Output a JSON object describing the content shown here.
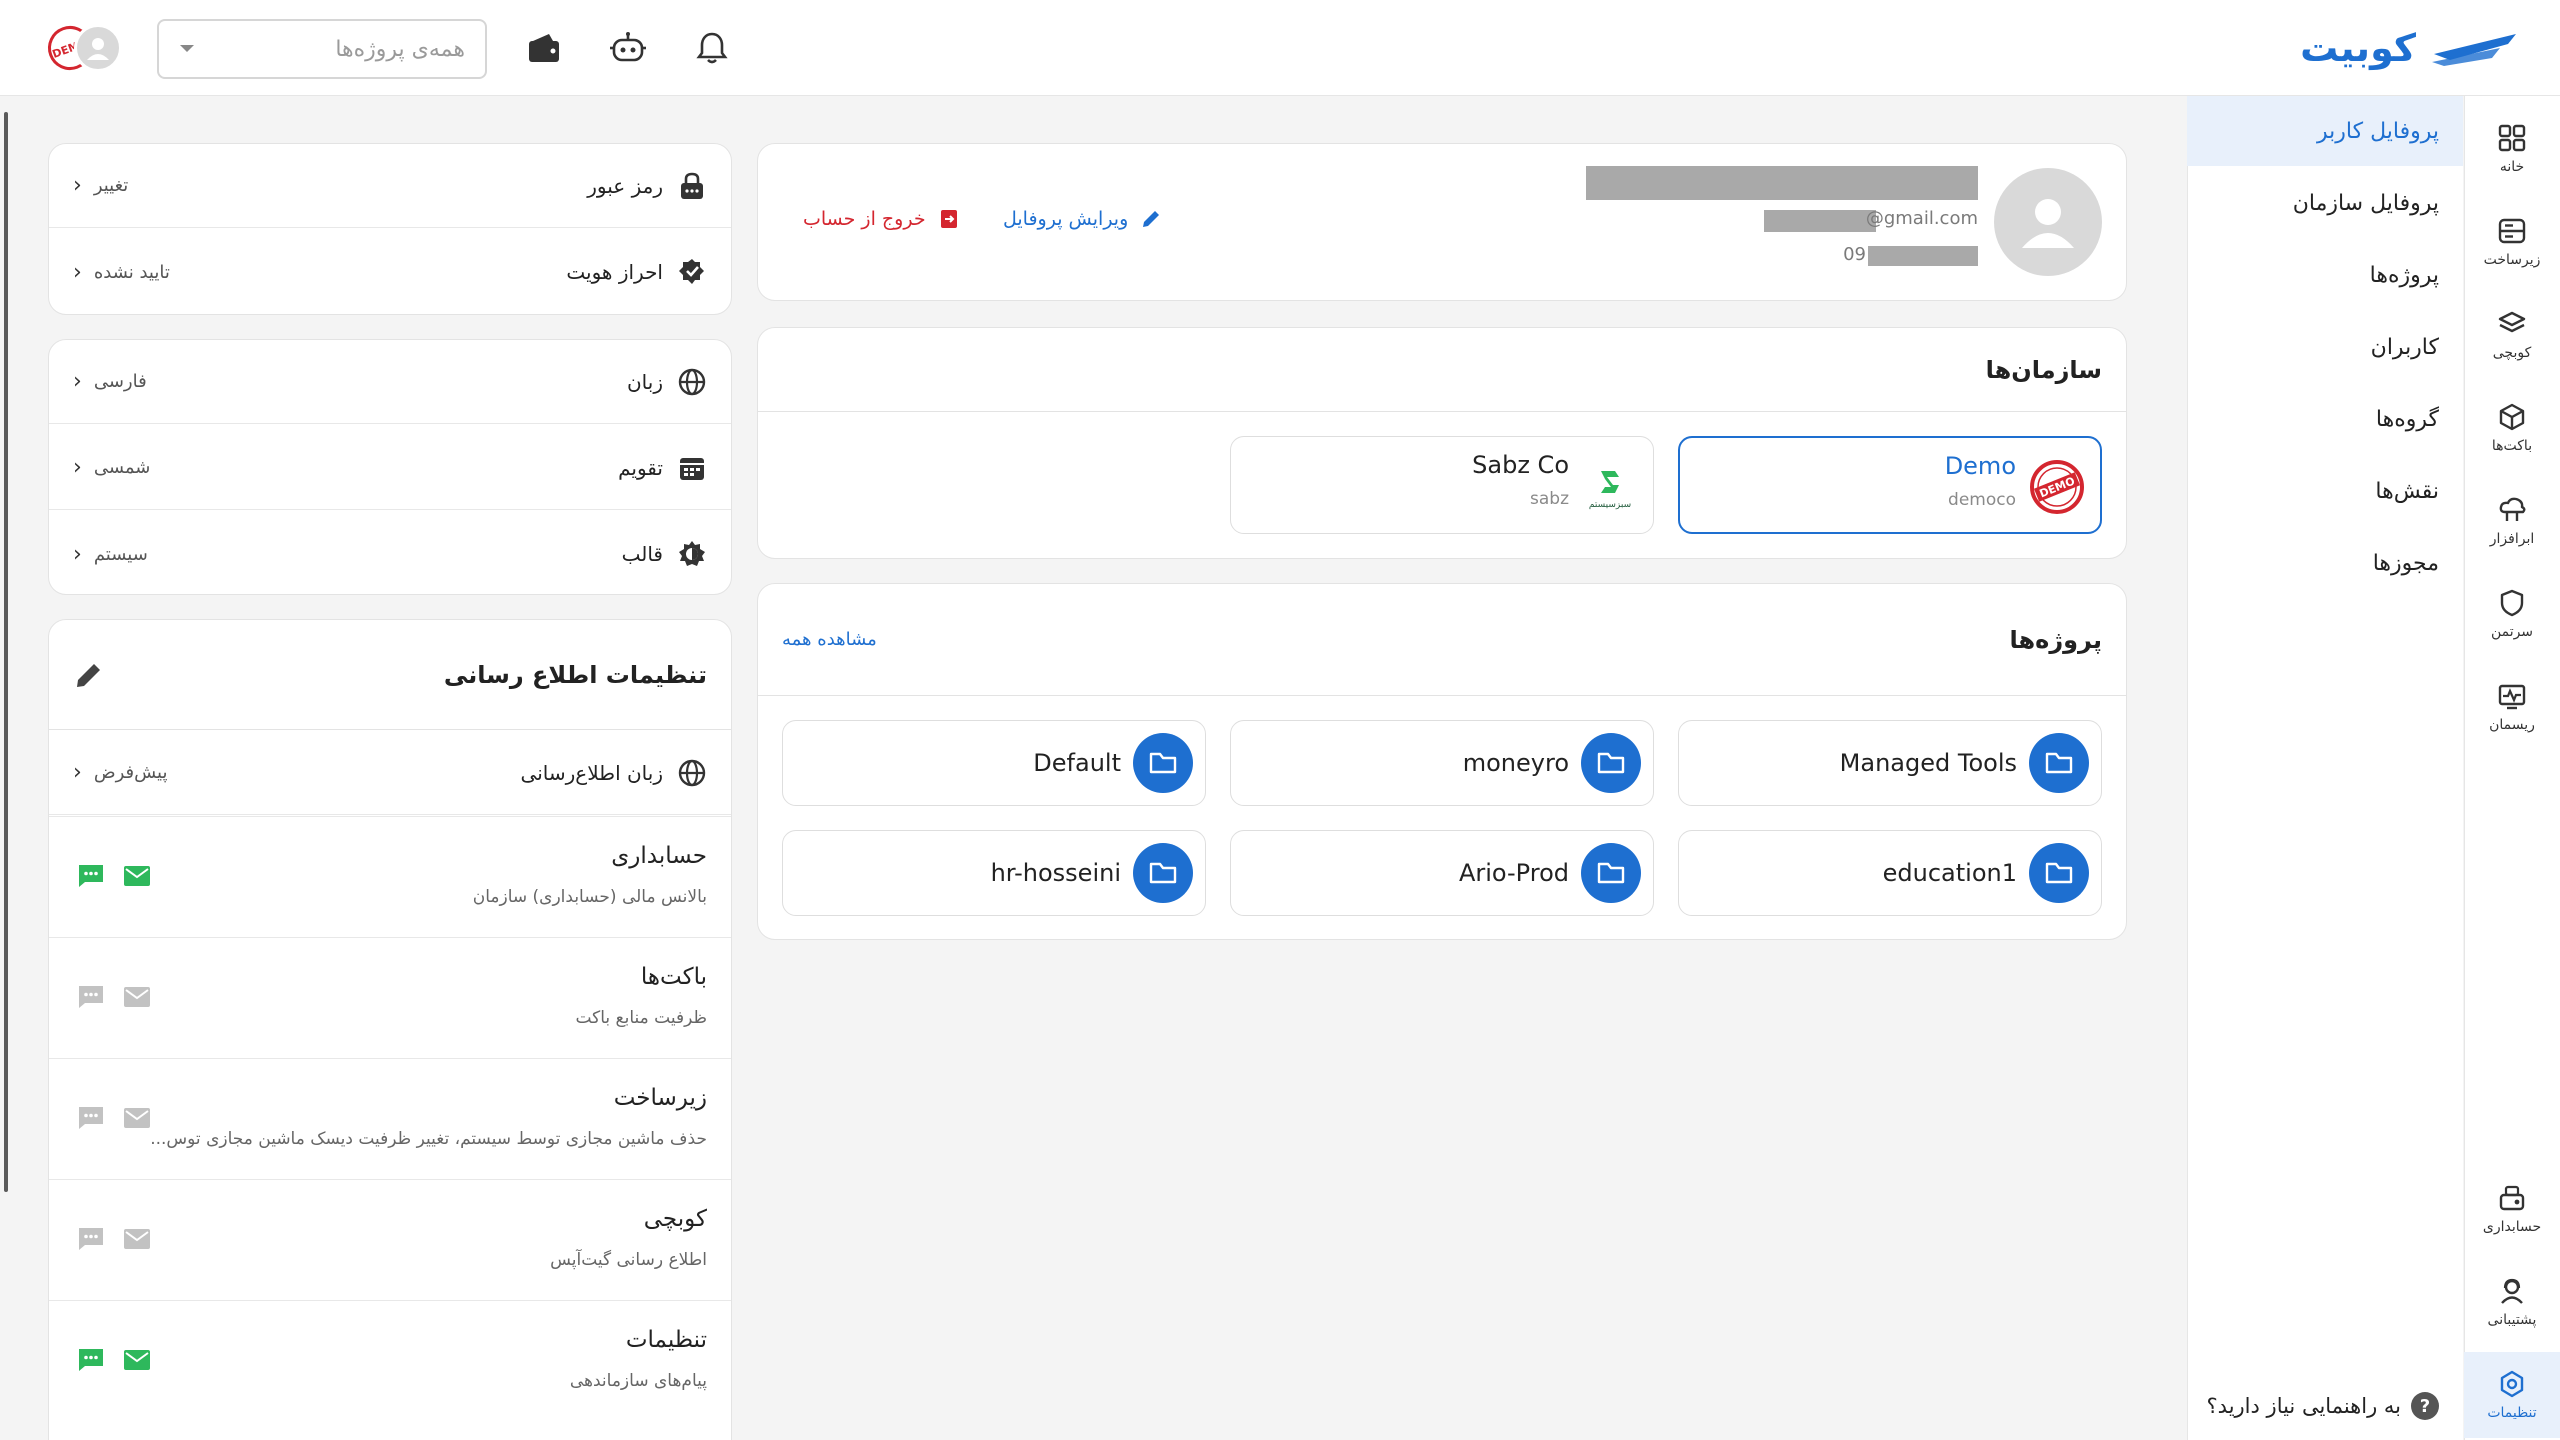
{
  "brand": {
    "name": "کوبیت"
  },
  "topbar": {
    "project_select_placeholder": "همه‌ی پروژه‌ها",
    "avatar_badge": "DEMO"
  },
  "rail": [
    {
      "label": "خانه",
      "icon": "grid-icon"
    },
    {
      "label": "زیرساخت",
      "icon": "server-icon"
    },
    {
      "label": "کوبچی",
      "icon": "layers-icon"
    },
    {
      "label": "باکت‌ها",
      "icon": "cube-icon"
    },
    {
      "label": "ابرافزار",
      "icon": "cloud-app-icon"
    },
    {
      "label": "سرتمن",
      "icon": "shield-icon"
    },
    {
      "label": "ریسمان",
      "icon": "monitor-wave-icon"
    }
  ],
  "rail_bottom": [
    {
      "label": "حسابداری",
      "icon": "accounting-icon"
    },
    {
      "label": "پشتیبانی",
      "icon": "support-icon"
    },
    {
      "label": "تنظیمات",
      "icon": "settings-icon"
    }
  ],
  "submenu": {
    "items": [
      "پروفایل کاربر",
      "پروفایل سازمان",
      "پروژه‌ها",
      "کاربران",
      "گروه‌ها",
      "نقش‌ها",
      "مجوزها"
    ],
    "help": "به راهنمایی نیاز دارید؟",
    "help_mark": "?"
  },
  "profile": {
    "email_suffix": "@gmail.com",
    "phone_prefix": "09",
    "edit_label": "ویرایش پروفایل",
    "logout_label": "خروج از حساب"
  },
  "orgs": {
    "title": "سازمان‌ها",
    "items": [
      {
        "name": "Demo",
        "slug": "democo",
        "logo": "DEMO"
      },
      {
        "name": "Sabz Co",
        "slug": "sabz",
        "logo": "سبزسیستم"
      }
    ]
  },
  "projects": {
    "title": "پروژه‌ها",
    "view_all": "مشاهده همه",
    "items": [
      "Managed Tools",
      "moneyro",
      "Default",
      "education1",
      "Ario-Prod",
      "hr-hosseini"
    ]
  },
  "security": {
    "rows": [
      {
        "label": "رمز عبور",
        "value": "تغییر"
      },
      {
        "label": "احراز هویت",
        "value": "تایید نشده"
      }
    ]
  },
  "preferences": {
    "rows": [
      {
        "label": "زبان",
        "value": "فارسی"
      },
      {
        "label": "تقویم",
        "value": "شمسی"
      },
      {
        "label": "قالب",
        "value": "سیستم"
      }
    ]
  },
  "notifications": {
    "title": "تنظیمات اطلاع رسانی",
    "language_label": "زبان اطلاع‌رسانی",
    "language_value": "پیش‌فرض",
    "items": [
      {
        "title": "حسابداری",
        "desc": "بالانس مالی (حسابداری) سازمان",
        "sms": true,
        "email": true
      },
      {
        "title": "باکت‌ها",
        "desc": "ظرفیت منابع باکت",
        "sms": false,
        "email": false
      },
      {
        "title": "زیرساخت",
        "desc": "حذف ماشین مجازی توسط سیستم، تغییر ظرفیت دیسک ماشین مجازی توس...",
        "sms": false,
        "email": false
      },
      {
        "title": "کوبچی",
        "desc": "اطلاع رسانی گیت‌آپس",
        "sms": false,
        "email": false
      },
      {
        "title": "تنظیمات",
        "desc": "پیام‌های سازماندهی",
        "sms": true,
        "email": true
      }
    ]
  },
  "colors": {
    "accent": "#1e6fd0",
    "danger": "#d4262f",
    "success": "#2eb85c",
    "muted": "#c2c2c2"
  }
}
